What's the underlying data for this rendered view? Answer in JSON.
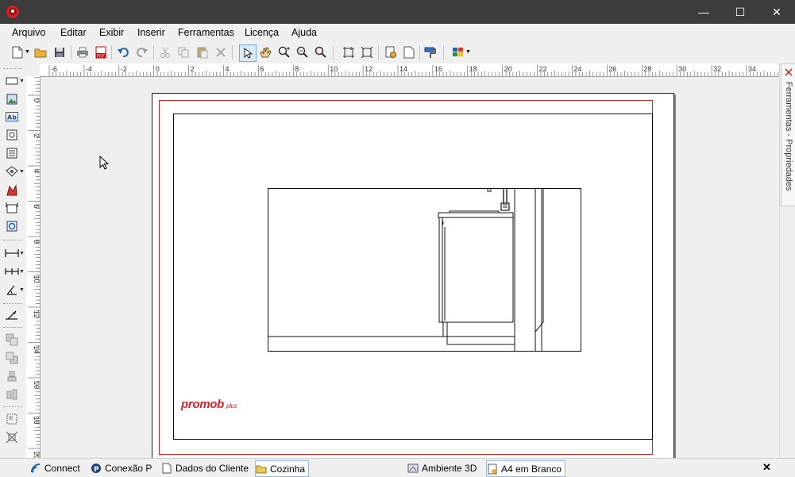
{
  "menu": [
    "Arquivo",
    "Editar",
    "Exibir",
    "Inserir",
    "Ferramentas",
    "Licença",
    "Ajuda"
  ],
  "window_controls": {
    "minimize": "—",
    "maximize": "☐",
    "close": "✕"
  },
  "ruler": {
    "h_labels": [
      "-6",
      "-4",
      "-2",
      "0",
      "2",
      "4",
      "6",
      "8",
      "10",
      "12",
      "14",
      "16",
      "18",
      "20",
      "22",
      "24",
      "26",
      "28",
      "30",
      "32",
      "34"
    ],
    "v_labels": [
      "0",
      "2",
      "4",
      "6",
      "8",
      "10",
      "12",
      "14",
      "16",
      "18",
      "20"
    ]
  },
  "logo": {
    "main": "promob",
    "sub": "plus"
  },
  "right_panel": {
    "label": "Ferramentas - Propriedades",
    "close": "✕"
  },
  "bottom_tabs": [
    "Connect",
    "Conexão P",
    "Dados do Cliente",
    "Cozinha",
    "Ambiente 3D",
    "A4 em Branco"
  ],
  "bottom_close": "✕",
  "colors": {
    "titlebar": "#3c3c3c",
    "accent_red": "#d6222e",
    "margin_red": "#e21a1a"
  }
}
